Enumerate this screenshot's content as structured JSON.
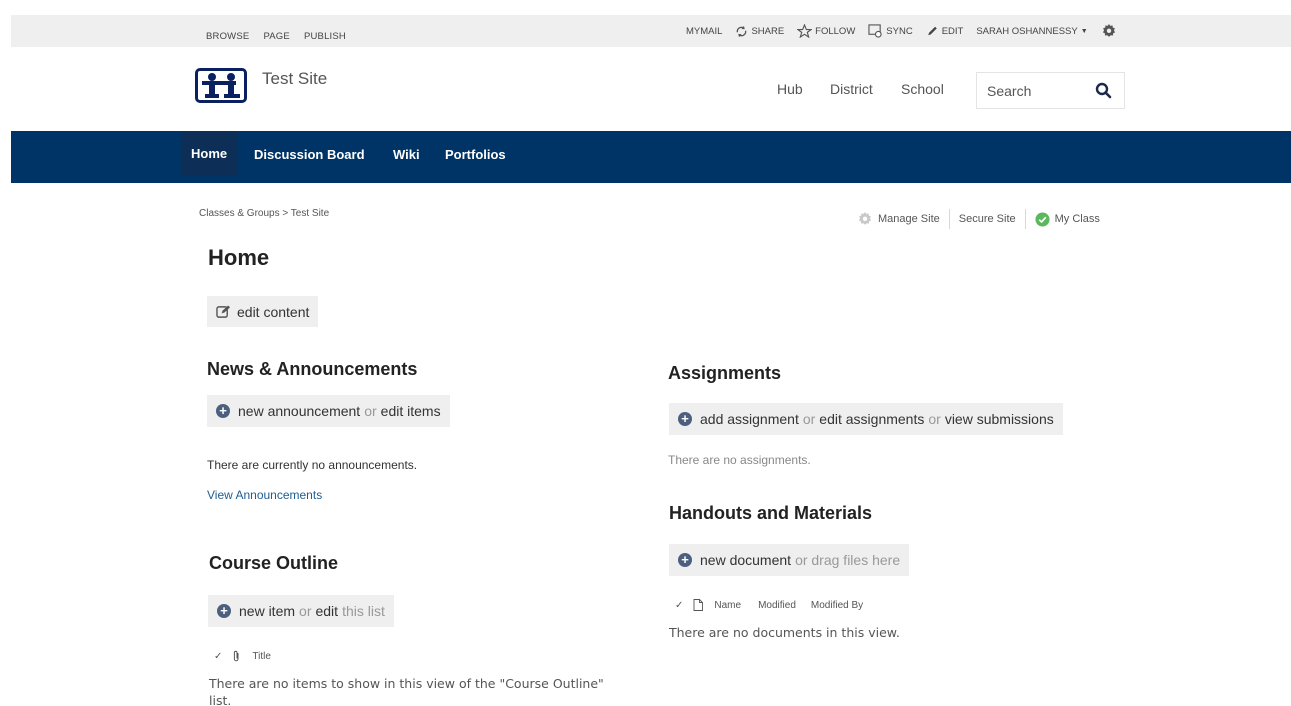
{
  "suitebar": {
    "left": [
      "BROWSE",
      "PAGE",
      "PUBLISH"
    ],
    "mymail": "MYMAIL",
    "share": "SHARE",
    "follow": "FOLLOW",
    "sync": "SYNC",
    "edit": "EDIT",
    "user": "SARAH OSHANNESSY"
  },
  "header": {
    "site_title": "Test Site",
    "nav": [
      "Hub",
      "District",
      "School"
    ],
    "search_placeholder": "Search"
  },
  "globalnav": {
    "items": [
      "Home",
      "Discussion Board",
      "Wiki",
      "Portfolios"
    ]
  },
  "breadcrumb": "Classes & Groups > Test Site",
  "site_actions": {
    "manage": "Manage Site",
    "secure": "Secure Site",
    "myclass": "My Class"
  },
  "page_title": "Home",
  "edit_content": "edit content",
  "news": {
    "title": "News & Announcements",
    "new_label": "new announcement",
    "or": "or",
    "edit_label": "edit items",
    "empty": "There are currently no announcements.",
    "view_link": "View Announcements"
  },
  "course_outline": {
    "title": "Course Outline",
    "new_label": "new item",
    "or": "or",
    "edit_label": "edit",
    "this_list": "this list",
    "col_title": "Title",
    "empty": "There are no items to show in this view of the \"Course Outline\" list."
  },
  "assignments": {
    "title": "Assignments",
    "add_label": "add assignment",
    "or": "or",
    "edit_label": "edit assignments",
    "view_label": "view submissions",
    "empty": "There are no assignments."
  },
  "handouts": {
    "title": "Handouts and Materials",
    "new_label": "new document",
    "drag_label": "or drag files here",
    "columns": [
      "Name",
      "Modified",
      "Modified By"
    ],
    "empty": "There are no documents in this view."
  }
}
